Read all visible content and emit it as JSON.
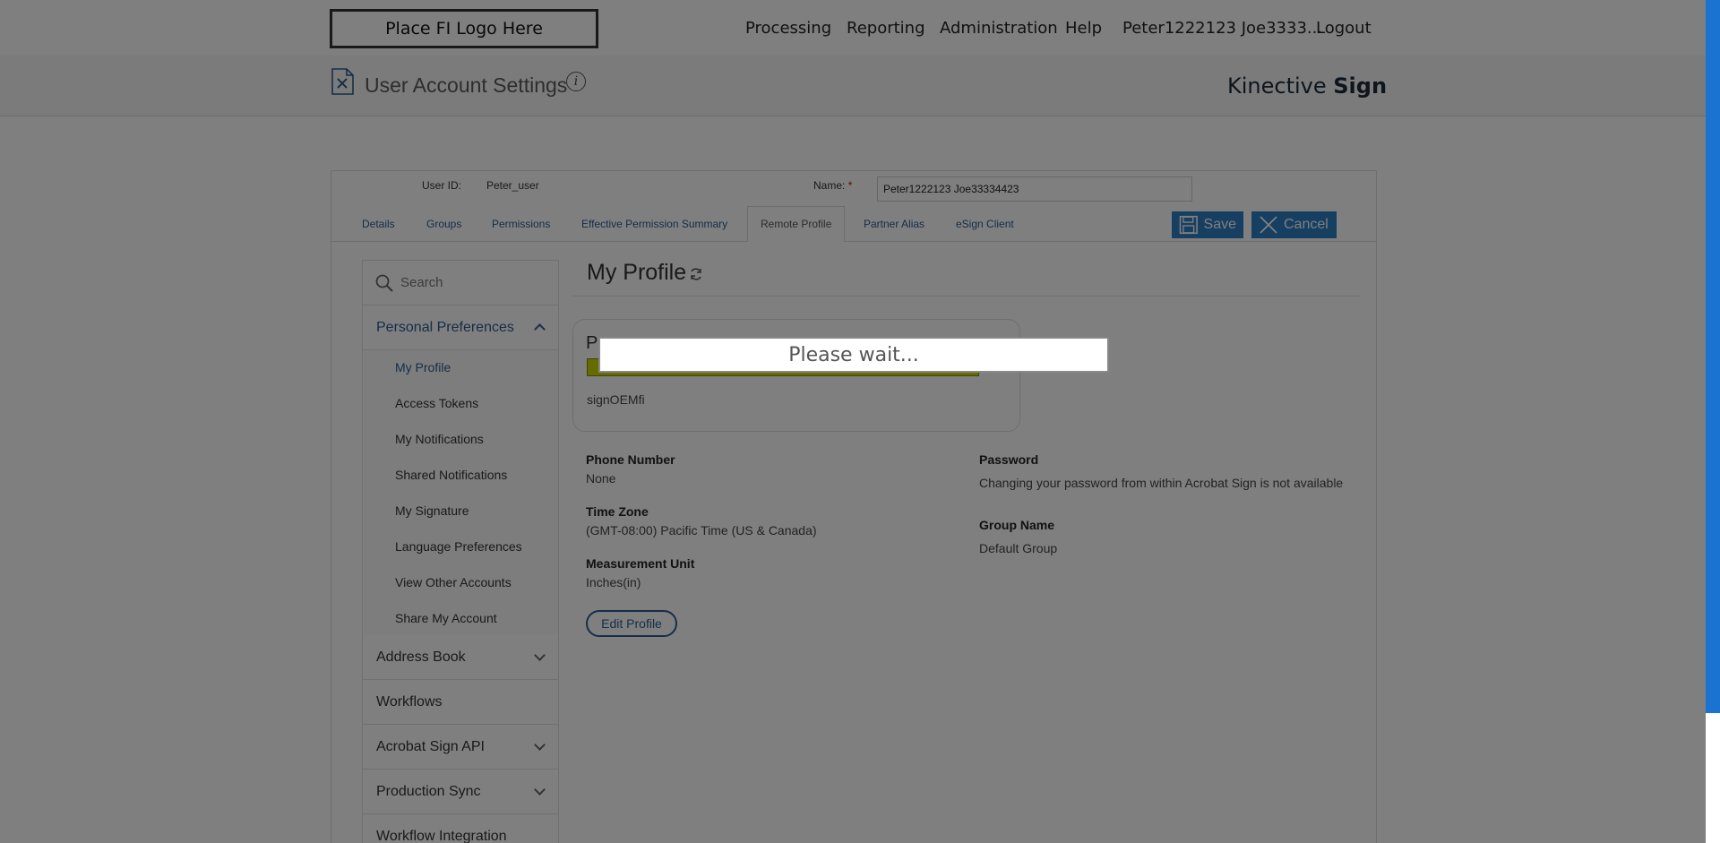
{
  "topbar": {
    "logo_text": "Place FI Logo Here",
    "nav": [
      "Processing",
      "Reporting",
      "Administration",
      "Help",
      "Peter1222123 Joe3333...",
      "Logout"
    ]
  },
  "header": {
    "title": "User Account Settings",
    "info_glyph": "i",
    "brand_light": "Kinective",
    "brand_bold": "Sign"
  },
  "user": {
    "id_label": "User ID:",
    "id_value": "Peter_user",
    "name_label": "Name:",
    "name_required": "*",
    "name_value": "Peter1222123 Joe33334423"
  },
  "tabs": [
    "Details",
    "Groups",
    "Permissions",
    "Effective Permission Summary",
    "Remote Profile",
    "Partner Alias",
    "eSign Client"
  ],
  "active_tab": "Remote Profile",
  "actions": {
    "save": "Save",
    "cancel": "Cancel"
  },
  "sidebar": {
    "search_placeholder": "Search",
    "sections": [
      {
        "label": "Personal Preferences",
        "expanded": true
      },
      {
        "label": "Address Book",
        "expanded": false
      },
      {
        "label": "Workflows",
        "expanded": false
      },
      {
        "label": "Acrobat Sign API",
        "expanded": false
      },
      {
        "label": "Production Sync",
        "expanded": false
      },
      {
        "label": "Workflow Integration",
        "expanded": false
      }
    ],
    "sub_items": [
      "My Profile",
      "Access Tokens",
      "My Notifications",
      "Shared Notifications",
      "My Signature",
      "Language Preferences",
      "View Other Accounts",
      "Share My Account"
    ],
    "active_sub": "My Profile"
  },
  "main": {
    "title": "My Profile",
    "card_initial": "P",
    "card_subtitle": "signOEMfi",
    "fields": {
      "phone_label": "Phone Number",
      "phone_value": "None",
      "tz_label": "Time Zone",
      "tz_value": "(GMT-08:00) Pacific Time (US & Canada)",
      "unit_label": "Measurement Unit",
      "unit_value": "Inches(in)",
      "password_label": "Password",
      "password_value": "Changing your password from within Acrobat Sign is not available",
      "group_label": "Group Name",
      "group_value": "Default Group"
    },
    "edit_button": "Edit Profile"
  },
  "overlay": {
    "message": "Please wait..."
  },
  "colors": {
    "accent": "#2a5d8f",
    "button_blue": "#2e7fc4",
    "scrollbar": "#1a73d1",
    "highlight": "#c9d900"
  },
  "icons": [
    "page-settings-icon",
    "info-icon",
    "save-icon",
    "close-icon",
    "search-icon",
    "chevron-up-icon",
    "chevron-down-icon",
    "refresh-icon"
  ]
}
